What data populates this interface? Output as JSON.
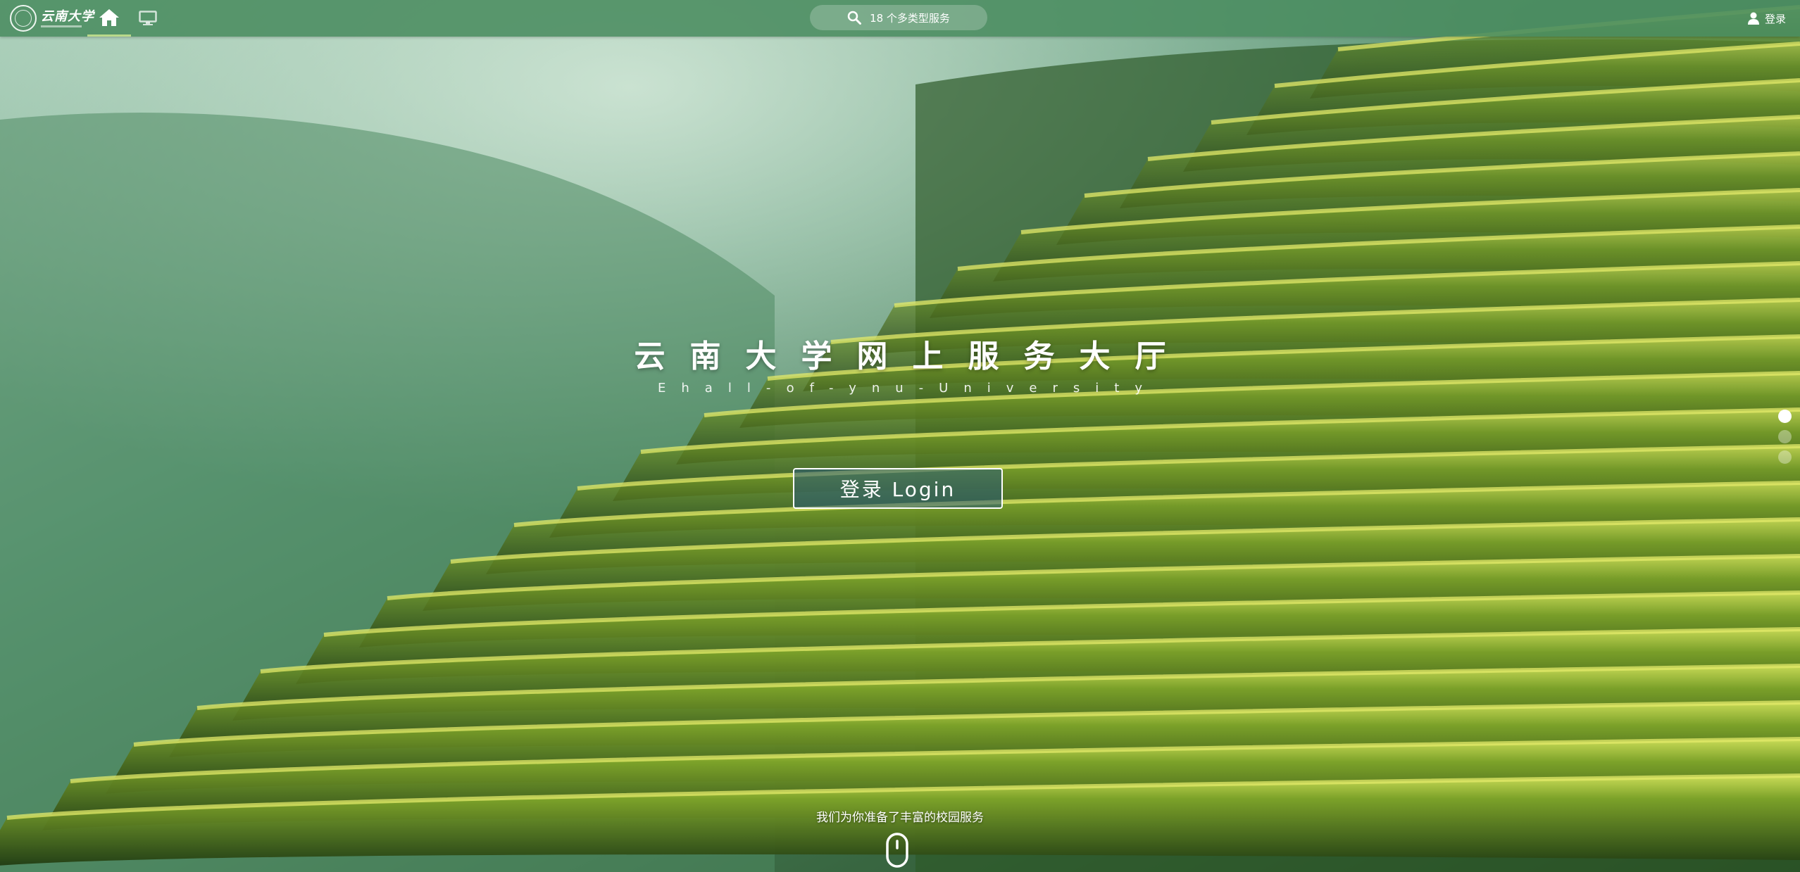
{
  "app": {
    "logo_text": "云南大学"
  },
  "topbar": {
    "search_text": "18 个多类型服务",
    "login_label": "登录"
  },
  "hero": {
    "title": "云南大学网上服务大厅",
    "subtitle": "Ehall-of-ynu-University",
    "login_button": "登录 Login"
  },
  "pager": {
    "total": 3,
    "active_index": 0
  },
  "footer": {
    "caption": "我们为你准备了丰富的校园服务"
  },
  "colors": {
    "topbar": "#4a8c60",
    "accent_underline": "#b9d98a"
  },
  "icons": [
    "home-icon",
    "desktop-icon",
    "search-icon",
    "user-icon",
    "mouse-scroll-icon"
  ]
}
